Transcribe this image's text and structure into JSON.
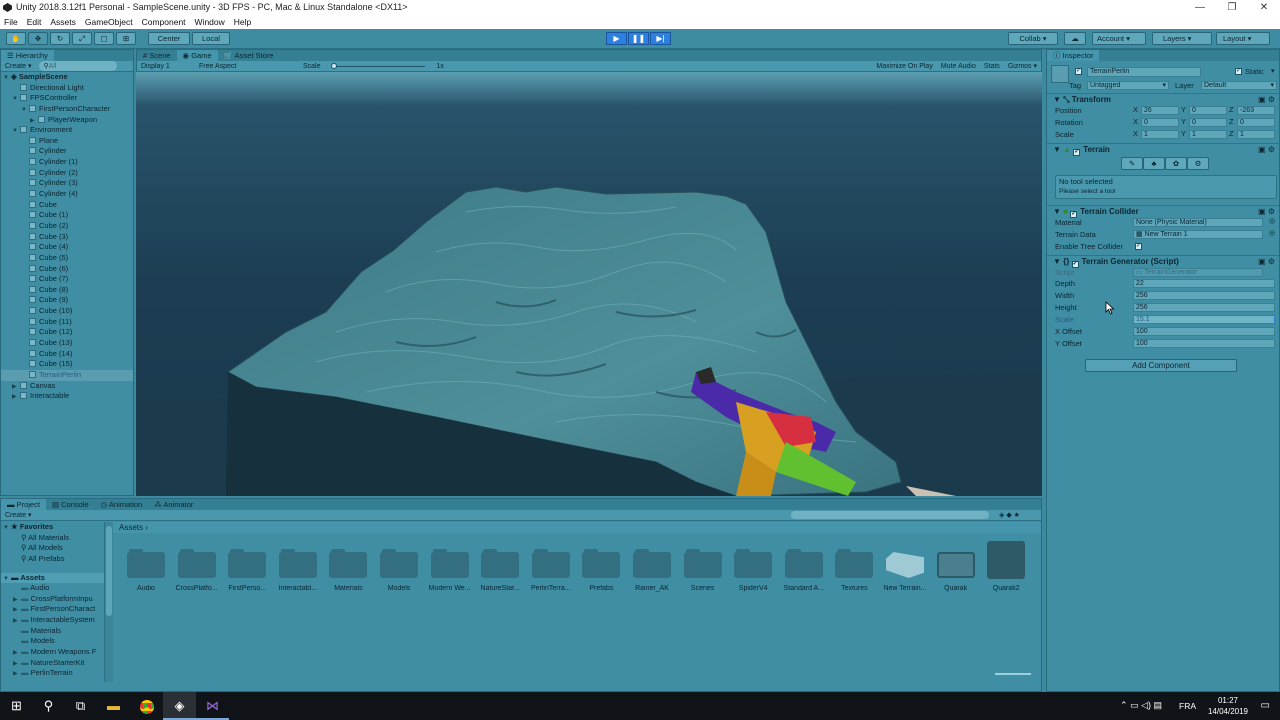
{
  "window": {
    "title": "Unity 2018.3.12f1 Personal - SampleScene.unity - 3D FPS - PC, Mac & Linux Standalone <DX11>",
    "controls": [
      "—",
      "❐",
      "✕"
    ]
  },
  "menu": [
    "File",
    "Edit",
    "Assets",
    "GameObject",
    "Component",
    "Window",
    "Help"
  ],
  "toolbar": {
    "center_label": "Center",
    "local_label": "Local",
    "collab_label": "Collab ▾",
    "account_label": "Account",
    "layers_label": "Layers",
    "layout_label": "Layout"
  },
  "hierarchy": {
    "tab": "Hierarchy",
    "create": "Create ▾",
    "search_placeholder": "All",
    "scene": "SampleScene",
    "items": [
      {
        "label": "Directional Light",
        "indent": 1
      },
      {
        "label": "FPSController",
        "indent": 1,
        "expanded": true
      },
      {
        "label": "FirstPersonCharacter",
        "indent": 2,
        "expanded": true
      },
      {
        "label": "PlayerWeapon",
        "indent": 3,
        "collapsed": true
      },
      {
        "label": "Environment",
        "indent": 1,
        "expanded": true
      },
      {
        "label": "Plane",
        "indent": 2
      },
      {
        "label": "Cylinder",
        "indent": 2
      },
      {
        "label": "Cylinder (1)",
        "indent": 2
      },
      {
        "label": "Cylinder (2)",
        "indent": 2
      },
      {
        "label": "Cylinder (3)",
        "indent": 2
      },
      {
        "label": "Cylinder (4)",
        "indent": 2
      },
      {
        "label": "Cube",
        "indent": 2
      },
      {
        "label": "Cube (1)",
        "indent": 2
      },
      {
        "label": "Cube (2)",
        "indent": 2
      },
      {
        "label": "Cube (3)",
        "indent": 2
      },
      {
        "label": "Cube (4)",
        "indent": 2
      },
      {
        "label": "Cube (5)",
        "indent": 2
      },
      {
        "label": "Cube (6)",
        "indent": 2
      },
      {
        "label": "Cube (7)",
        "indent": 2
      },
      {
        "label": "Cube (8)",
        "indent": 2
      },
      {
        "label": "Cube (9)",
        "indent": 2
      },
      {
        "label": "Cube (10)",
        "indent": 2
      },
      {
        "label": "Cube (11)",
        "indent": 2
      },
      {
        "label": "Cube (12)",
        "indent": 2
      },
      {
        "label": "Cube (13)",
        "indent": 2
      },
      {
        "label": "Cube (14)",
        "indent": 2
      },
      {
        "label": "Cube (15)",
        "indent": 2
      },
      {
        "label": "TerrainPerlin",
        "indent": 2,
        "selected": true
      },
      {
        "label": "Canvas",
        "indent": 1,
        "collapsed": true
      },
      {
        "label": "Interactable",
        "indent": 1,
        "collapsed": true
      }
    ]
  },
  "view_tabs": {
    "scene": "Scene",
    "game": "Game",
    "asset_store": "Asset Store"
  },
  "game_bar": {
    "display": "Display 1",
    "aspect": "Free Aspect",
    "scale_label": "Scale",
    "scale_value": "1x",
    "toggles": [
      "Maximize On Play",
      "Mute Audio",
      "Stats",
      "Gizmos ▾"
    ]
  },
  "inspector": {
    "tab": "Inspector",
    "object_name": "TerrainPerlin",
    "static_label": "Static",
    "tag_label": "Tag",
    "tag_value": "Untagged",
    "layer_label": "Layer",
    "layer_value": "Default",
    "transform": {
      "title": "Transform",
      "position": {
        "label": "Position",
        "x": "26",
        "y": "0",
        "z": "-263"
      },
      "rotation": {
        "label": "Rotation",
        "x": "0",
        "y": "0",
        "z": "0"
      },
      "scale": {
        "label": "Scale",
        "x": "1",
        "y": "1",
        "z": "1"
      }
    },
    "terrain": {
      "title": "Terrain",
      "no_tool": "No tool selected",
      "please_select": "Please select a tool"
    },
    "terrain_collider": {
      "title": "Terrain Collider",
      "material_label": "Material",
      "material_value": "None (Physic Material)",
      "data_label": "Terrain Data",
      "data_value": "New Terrain 1",
      "tree_label": "Enable Tree Collider"
    },
    "terrain_generator": {
      "title": "Terrain Generator (Script)",
      "script_label": "Script",
      "script_value": "TerrainGenerator",
      "fields": [
        {
          "label": "Depth",
          "value": "22"
        },
        {
          "label": "Width",
          "value": "256"
        },
        {
          "label": "Height",
          "value": "256"
        },
        {
          "label": "Scale",
          "value": "15.1",
          "selected": true
        },
        {
          "label": "X Offset",
          "value": "100"
        },
        {
          "label": "Y Offset",
          "value": "100"
        }
      ]
    },
    "add_component": "Add Component"
  },
  "project": {
    "tabs": [
      "Project",
      "Console",
      "Animation",
      "Animator"
    ],
    "create": "Create ▾",
    "favorites_title": "Favorites",
    "favorites": [
      "All Materials",
      "All Models",
      "All Prefabs"
    ],
    "assets_title": "Assets",
    "tree": [
      "Audio",
      "CrossPlatformInpu",
      "FirstPersonCharact",
      "InteractableSystem",
      "Materials",
      "Models",
      "Modern Weapons F",
      "NatureStarterKit",
      "PerlinTerrain"
    ],
    "breadcrumb": "Assets",
    "assets": [
      "Audio",
      "CrossPlatfo...",
      "FirstPerso...",
      "Interactabl...",
      "Materials",
      "Models",
      "Modern We...",
      "NatureStar...",
      "PerlinTerra...",
      "Prefabs",
      "Rainer_AK",
      "Scenes",
      "SpiderV4",
      "Standard A...",
      "Textures",
      "New Terrain...",
      "Quarak",
      "Quarak2"
    ]
  },
  "taskbar": {
    "lang": "FRA",
    "time": "01:27",
    "date": "14/04/2019"
  }
}
